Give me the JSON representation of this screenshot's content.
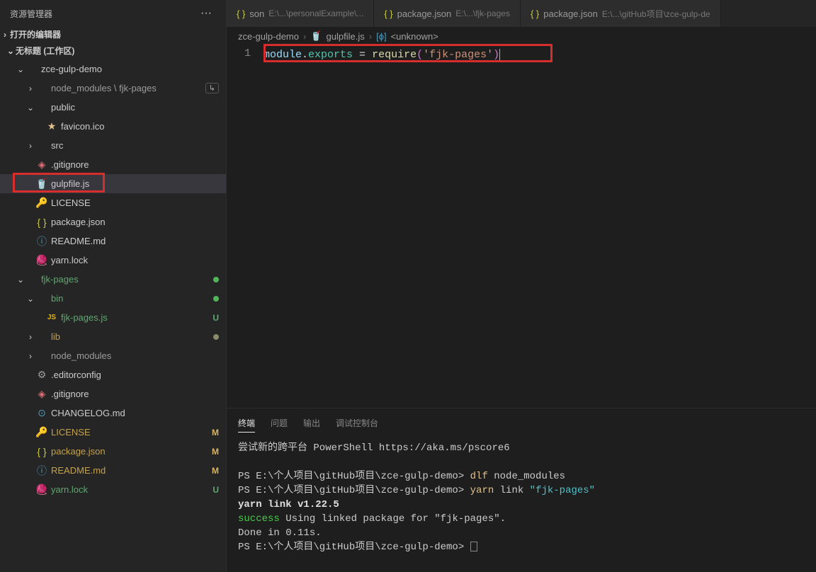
{
  "sidebar": {
    "title": "资源管理器",
    "open_editors": "打开的编辑器",
    "workspace": "无标题 (工作区)"
  },
  "tree": {
    "items": [
      {
        "depth": 1,
        "chev": "v",
        "icon": "",
        "label": "zce-gulp-demo",
        "class": ""
      },
      {
        "depth": 2,
        "chev": ">",
        "icon": "",
        "label": "node_modules \\ fjk-pages",
        "class": "folder-muted",
        "badge": "shortcut"
      },
      {
        "depth": 2,
        "chev": "v",
        "icon": "",
        "label": "public",
        "class": ""
      },
      {
        "depth": 3,
        "chev": "",
        "icon": "star",
        "label": "favicon.ico",
        "class": ""
      },
      {
        "depth": 2,
        "chev": ">",
        "icon": "",
        "label": "src",
        "class": ""
      },
      {
        "depth": 2,
        "chev": "",
        "icon": "git",
        "label": ".gitignore",
        "class": ""
      },
      {
        "depth": 2,
        "chev": "",
        "icon": "gulp",
        "label": "gulpfile.js",
        "class": "",
        "selected": true,
        "boxed": true
      },
      {
        "depth": 2,
        "chev": "",
        "icon": "lic",
        "label": "LICENSE",
        "class": ""
      },
      {
        "depth": 2,
        "chev": "",
        "icon": "json",
        "label": "package.json",
        "class": ""
      },
      {
        "depth": 2,
        "chev": "",
        "icon": "readme",
        "label": "README.md",
        "class": ""
      },
      {
        "depth": 2,
        "chev": "",
        "icon": "yarn",
        "label": "yarn.lock",
        "class": ""
      },
      {
        "depth": 1,
        "chev": "v",
        "icon": "",
        "label": "fjk-pages",
        "class": "git-green",
        "dot": "green"
      },
      {
        "depth": 2,
        "chev": "v",
        "icon": "",
        "label": "bin",
        "class": "git-green",
        "dot": "green"
      },
      {
        "depth": 3,
        "chev": "",
        "icon": "js",
        "label": "fjk-pages.js",
        "class": "git-green",
        "git": "U"
      },
      {
        "depth": 2,
        "chev": ">",
        "icon": "",
        "label": "lib",
        "class": "git-yellow",
        "dot": "gray"
      },
      {
        "depth": 2,
        "chev": ">",
        "icon": "",
        "label": "node_modules",
        "class": "folder-muted"
      },
      {
        "depth": 2,
        "chev": "",
        "icon": "gear",
        "label": ".editorconfig",
        "class": ""
      },
      {
        "depth": 2,
        "chev": "",
        "icon": "git",
        "label": ".gitignore",
        "class": ""
      },
      {
        "depth": 2,
        "chev": "",
        "icon": "info",
        "label": "CHANGELOG.md",
        "class": ""
      },
      {
        "depth": 2,
        "chev": "",
        "icon": "lic",
        "label": "LICENSE",
        "class": "git-yellow",
        "git": "M"
      },
      {
        "depth": 2,
        "chev": "",
        "icon": "json",
        "label": "package.json",
        "class": "git-yellow",
        "git": "M"
      },
      {
        "depth": 2,
        "chev": "",
        "icon": "readme",
        "label": "README.md",
        "class": "git-yellow",
        "git": "M"
      },
      {
        "depth": 2,
        "chev": "",
        "icon": "yarn",
        "label": "yarn.lock",
        "class": "git-green",
        "git": "U"
      }
    ]
  },
  "tabs": [
    {
      "icon": "json",
      "title": "son",
      "dim": "E:\\...\\personalExample\\..."
    },
    {
      "icon": "json",
      "title": "package.json",
      "dim": "E:\\...\\fjk-pages"
    },
    {
      "icon": "json",
      "title": "package.json",
      "dim": "E:\\...\\gitHub项目\\zce-gulp-de"
    }
  ],
  "breadcrumb": {
    "seg1": "zce-gulp-demo",
    "seg2": "gulpfile.js",
    "seg3": "<unknown>"
  },
  "editor": {
    "line_no": "1",
    "t1": "module",
    "t2": ".",
    "t3": "exports",
    "t4": " = ",
    "t5": "require",
    "t6": "(",
    "t7": "'fjk-pages'",
    "t8": ")"
  },
  "panel": {
    "tabs": {
      "terminal": "终端",
      "problems": "问题",
      "output": "输出",
      "debug": "调试控制台"
    },
    "l1": "尝试新的跨平台 PowerShell https://aka.ms/pscore6",
    "l2a": "PS E:\\个人项目\\gitHub项目\\zce-gulp-demo> ",
    "l2b": "dlf ",
    "l2c": "node_modules",
    "l3a": "PS E:\\个人项目\\gitHub项目\\zce-gulp-demo> ",
    "l3b": "yarn ",
    "l3c": "link ",
    "l3d": "\"fjk-pages\"",
    "l4": "yarn link v1.22.5",
    "l5a": "success",
    "l5b": " Using linked package for \"fjk-pages\".",
    "l6": "Done in 0.11s.",
    "l7": "PS E:\\个人项目\\gitHub项目\\zce-gulp-demo> "
  }
}
